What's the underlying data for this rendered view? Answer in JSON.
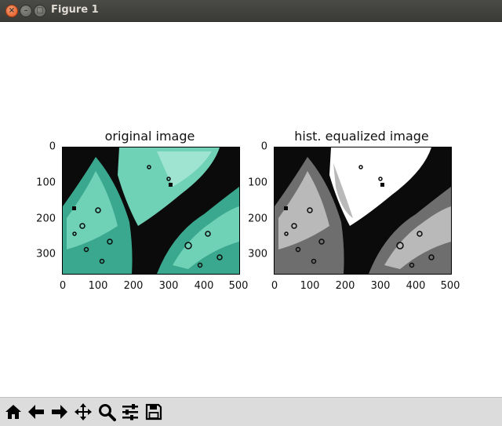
{
  "window": {
    "title": "Figure 1",
    "close_glyph": "×",
    "min_glyph": "–",
    "max_glyph": "□"
  },
  "figure": {
    "left_axes": {
      "title": "original image",
      "xticks": [
        "0",
        "100",
        "200",
        "300",
        "400",
        "500"
      ],
      "yticks": [
        "0",
        "100",
        "200",
        "300"
      ],
      "colors": {
        "dark": "#0b0b0b",
        "mid": "#3aa88e",
        "light": "#6fd1b6",
        "lightest": "#9ee4d1"
      }
    },
    "right_axes": {
      "title": "hist. equalized image",
      "xticks": [
        "0",
        "100",
        "200",
        "300",
        "400",
        "500"
      ],
      "yticks": [
        "0",
        "100",
        "200",
        "300"
      ],
      "colors": {
        "dark": "#0b0b0b",
        "mid": "#6e6e6e",
        "light": "#b9b9b9",
        "lightest": "#ffffff"
      }
    }
  },
  "toolbar": {
    "buttons": [
      {
        "name": "home-icon",
        "tooltip": "Reset original view"
      },
      {
        "name": "arrow-left-icon",
        "tooltip": "Back"
      },
      {
        "name": "arrow-right-icon",
        "tooltip": "Forward"
      },
      {
        "name": "pan-icon",
        "tooltip": "Pan"
      },
      {
        "name": "zoom-icon",
        "tooltip": "Zoom"
      },
      {
        "name": "sliders-icon",
        "tooltip": "Configure subplots"
      },
      {
        "name": "save-icon",
        "tooltip": "Save"
      }
    ]
  }
}
